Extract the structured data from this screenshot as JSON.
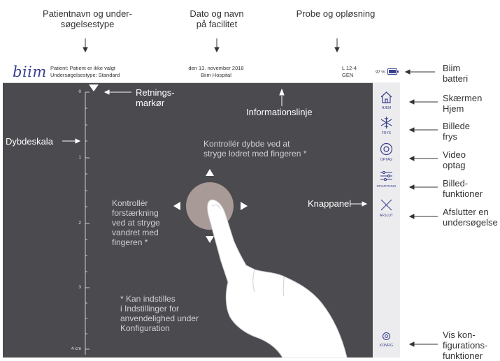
{
  "callouts": {
    "patient": "Patientnavn og under-\nsøgelsestype",
    "date": "Dato og navn\npå facilitet",
    "probe": "Probe og opløsning",
    "battery": "Biim\nbatteri",
    "home": "Skærmen\nHjem",
    "freeze": "Billede\nfrys",
    "video": "Video\noptag",
    "image_functions": "Billed-\nfunktioner",
    "exit": "Afslutter en\nundersøgelse",
    "config": "Vis kon-\nfigurations-\nfunktioner",
    "depth_scale": "Dybdeskala",
    "orientation": "Retnings-\nmarkør",
    "info_line": "Informationslinje",
    "button_panel": "Knappanel"
  },
  "header": {
    "logo": "biim",
    "patient_line": "Patient: Patient er ikke valgt",
    "exam_type_line": "Undersøgelsestype: Standard",
    "date": "den 13. november 2018",
    "facility": "Biim Hospital",
    "probe": "L 12-4",
    "resolution": "GEN",
    "battery_percent": "97 %"
  },
  "panel": {
    "home": "HJEM",
    "freeze": "FRYS",
    "record": "OPTAG",
    "settings": "OPSÆTNING",
    "exit": "AFSLUT",
    "config": "KONFIG"
  },
  "depth": {
    "labels": [
      "0",
      "1",
      "2",
      "3",
      "4 cm"
    ]
  },
  "instructions": {
    "depth": "Kontrollér dybde ved at\nstryge lodret med fingeren *",
    "gain": "Kontrollér\nforstærkning\nved at stryge\nvandret med\nfingeren *",
    "note": "* Kan indstilles\ni Indstillinger for\nanvendelighed under\nKonfiguration"
  },
  "colors": {
    "screen_bg": "#4a4a4f",
    "accent": "#3a3f8f",
    "battery": "#3a3f8f"
  }
}
